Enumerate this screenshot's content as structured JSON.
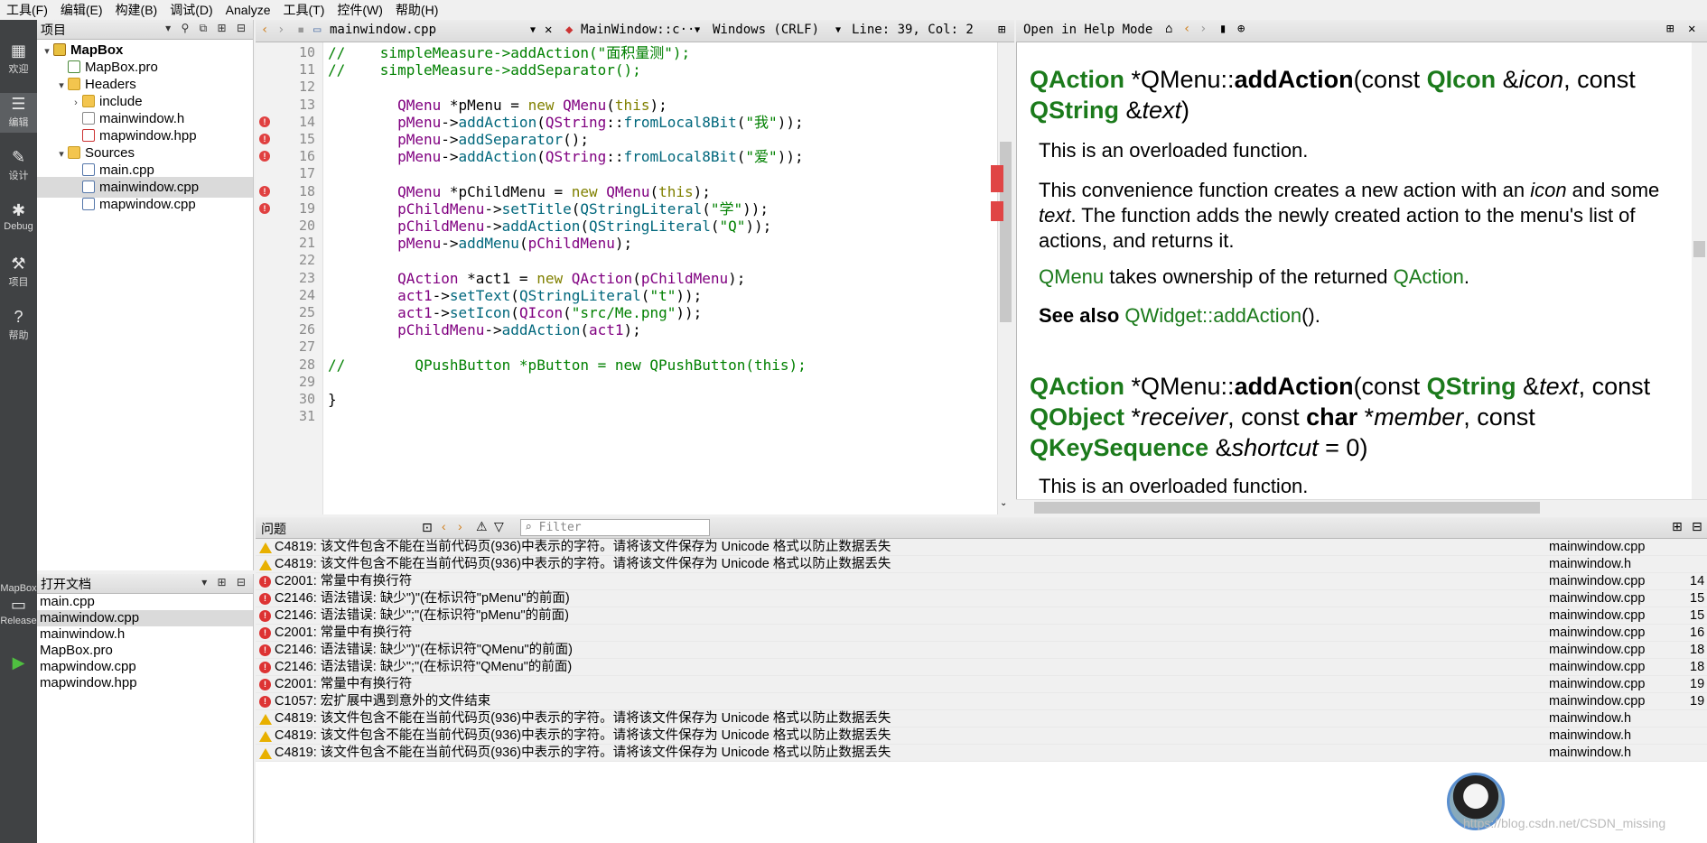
{
  "menubar": {
    "items": [
      {
        "label": "工具(F)"
      },
      {
        "label": "编辑(E)"
      },
      {
        "label": "构建(B)"
      },
      {
        "label": "调试(D)"
      },
      {
        "label": "Analyze"
      },
      {
        "label": "工具(T)"
      },
      {
        "label": "控件(W)"
      },
      {
        "label": "帮助(H)"
      }
    ]
  },
  "modebar": {
    "modes": [
      {
        "label": "欢迎",
        "icon": "grid-icon"
      },
      {
        "label": "编辑",
        "icon": "edit-icon"
      },
      {
        "label": "设计",
        "icon": "design-icon"
      },
      {
        "label": "Debug",
        "icon": "bug-icon"
      },
      {
        "label": "项目",
        "icon": "wrench-icon"
      },
      {
        "label": "帮助",
        "icon": "help-icon"
      }
    ],
    "kit_label": "MapBox",
    "build_label": "Release"
  },
  "project_pane": {
    "title": "项目",
    "tree": [
      {
        "label": "MapBox",
        "depth": 0,
        "kind": "root",
        "expanded": true
      },
      {
        "label": "MapBox.pro",
        "depth": 1,
        "kind": "pro"
      },
      {
        "label": "Headers",
        "depth": 1,
        "kind": "folder-h",
        "expanded": true
      },
      {
        "label": "include",
        "depth": 2,
        "kind": "folder",
        "expanded": false
      },
      {
        "label": "mainwindow.h",
        "depth": 2,
        "kind": "h"
      },
      {
        "label": "mapwindow.hpp",
        "depth": 2,
        "kind": "hpp"
      },
      {
        "label": "Sources",
        "depth": 1,
        "kind": "folder-s",
        "expanded": true
      },
      {
        "label": "main.cpp",
        "depth": 2,
        "kind": "cpp"
      },
      {
        "label": "mainwindow.cpp",
        "depth": 2,
        "kind": "cpp",
        "selected": true
      },
      {
        "label": "mapwindow.cpp",
        "depth": 2,
        "kind": "cpp"
      }
    ]
  },
  "open_docs": {
    "title": "打开文档",
    "items": [
      {
        "label": "main.cpp"
      },
      {
        "label": "mainwindow.cpp",
        "selected": true
      },
      {
        "label": "mainwindow.h"
      },
      {
        "label": "MapBox.pro"
      },
      {
        "label": "mapwindow.cpp"
      },
      {
        "label": "mapwindow.hpp"
      }
    ]
  },
  "editor": {
    "file_tab": "mainwindow.cpp",
    "symbol": "MainWindow::c···",
    "encoding": "Windows (CRLF)",
    "position": "Line: 39, Col: 2",
    "lines": [
      {
        "n": "10",
        "err": false,
        "html": "<span class=\"cm\">//    simpleMeasure-&gt;addAction(\"面积量测\");</span>"
      },
      {
        "n": "11",
        "err": false,
        "html": "<span class=\"cm\">//    simpleMeasure-&gt;addSeparator();</span>"
      },
      {
        "n": "12",
        "err": false,
        "html": ""
      },
      {
        "n": "13",
        "err": false,
        "html": "        <span class=\"ty\">QMenu</span> *pMenu = <span class=\"kw\">new</span> <span class=\"ty\">QMenu</span>(<span class=\"kw\">this</span>);"
      },
      {
        "n": "14",
        "err": true,
        "html": "        <span class=\"ty\">pMenu</span>-&gt;<span class=\"fn\">addAction</span>(<span class=\"ty\">QString</span>::<span class=\"fn\">fromLocal8Bit</span>(<span class=\"st\">\"我\"</span>));"
      },
      {
        "n": "15",
        "err": true,
        "html": "        <span class=\"ty\">pMenu</span>-&gt;<span class=\"fn\">addSeparator</span>();"
      },
      {
        "n": "16",
        "err": true,
        "html": "        <span class=\"ty\">pMenu</span>-&gt;<span class=\"fn\">addAction</span>(<span class=\"ty\">QString</span>::<span class=\"fn\">fromLocal8Bit</span>(<span class=\"st\">\"爱\"</span>));"
      },
      {
        "n": "17",
        "err": false,
        "html": ""
      },
      {
        "n": "18",
        "err": true,
        "html": "        <span class=\"ty\">QMenu</span> *pChildMenu = <span class=\"kw\">new</span> <span class=\"ty\">QMenu</span>(<span class=\"kw\">this</span>);"
      },
      {
        "n": "19",
        "err": true,
        "html": "        <span class=\"ty\">pChildMenu</span>-&gt;<span class=\"fn\">setTitle</span>(<span class=\"fn\">QStringLiteral</span>(<span class=\"st\">\"学\"</span>));"
      },
      {
        "n": "20",
        "err": false,
        "html": "        <span class=\"ty\">pChildMenu</span>-&gt;<span class=\"fn\">addAction</span>(<span class=\"fn\">QStringLiteral</span>(<span class=\"st\">\"Q\"</span>));"
      },
      {
        "n": "21",
        "err": false,
        "html": "        <span class=\"ty\">pMenu</span>-&gt;<span class=\"fn\">addMenu</span>(<span class=\"ty\">pChildMenu</span>);"
      },
      {
        "n": "22",
        "err": false,
        "html": ""
      },
      {
        "n": "23",
        "err": false,
        "html": "        <span class=\"ty\">QAction</span> *act1 = <span class=\"kw\">new</span> <span class=\"ty\">QAction</span>(<span class=\"ty\">pChildMenu</span>);"
      },
      {
        "n": "24",
        "err": false,
        "html": "        <span class=\"ty\">act1</span>-&gt;<span class=\"fn\">setText</span>(<span class=\"fn\">QStringLiteral</span>(<span class=\"st\">\"t\"</span>));"
      },
      {
        "n": "25",
        "err": false,
        "html": "        <span class=\"ty\">act1</span>-&gt;<span class=\"fn\">setIcon</span>(<span class=\"ty\">QIcon</span>(<span class=\"st\">\"src/Me.png\"</span>));"
      },
      {
        "n": "26",
        "err": false,
        "html": "        <span class=\"ty\">pChildMenu</span>-&gt;<span class=\"fn\">addAction</span>(<span class=\"ty\">act1</span>);"
      },
      {
        "n": "27",
        "err": false,
        "html": ""
      },
      {
        "n": "28",
        "err": false,
        "html": "<span class=\"cm\">//        QPushButton *pButton = new QPushButton(this);</span>"
      },
      {
        "n": "29",
        "err": false,
        "html": ""
      },
      {
        "n": "30",
        "err": false,
        "html": "}"
      },
      {
        "n": "31",
        "err": false,
        "html": ""
      }
    ]
  },
  "help": {
    "mode_label": "Open in Help Mode",
    "sig1_html": "<b class=\"q\">QAction</b> *QMenu::<b>addAction</b>(const <b class=\"q\">QIcon</b> &amp;<i>icon</i>, const <b class=\"q\">QString</b> &amp;<i>text</i>)",
    "p1": "This is an overloaded function.",
    "p2_html": "This convenience function creates a new action with an <i>icon</i> and some <i>text</i>. The function adds the newly created action to the menu's list of actions, and returns it.",
    "p3_html": "<span class=\"lnk\">QMenu</span> takes ownership of the returned <span class=\"lnk\">QAction</span>.",
    "p4_html": "<b>See also</b> <span class=\"lnk\">QWidget::addAction</span>().",
    "sig2_html": "<b class=\"q\">QAction</b> *QMenu::<b>addAction</b>(const <b class=\"q\">QString</b> &amp;<i>text</i>, const <b class=\"q\">QObject</b> *<i>receiver</i>, const <b>char</b> *<i>member</i>, const <b class=\"q\">QKeySequence</b> &amp;<i>shortcut</i> = 0)",
    "p5": "This is an overloaded function."
  },
  "issues": {
    "title": "问题",
    "filter_placeholder": "Filter",
    "rows": [
      {
        "type": "warning",
        "msg": "C4819: 该文件包含不能在当前代码页(936)中表示的字符。请将该文件保存为 Unicode 格式以防止数据丢失",
        "file": "mainwindow.cpp",
        "line": ""
      },
      {
        "type": "warning",
        "msg": "C4819: 该文件包含不能在当前代码页(936)中表示的字符。请将该文件保存为 Unicode 格式以防止数据丢失",
        "file": "mainwindow.h",
        "line": ""
      },
      {
        "type": "error",
        "msg": "C2001: 常量中有换行符",
        "file": "mainwindow.cpp",
        "line": "14"
      },
      {
        "type": "error",
        "msg": "C2146: 语法错误: 缺少\")\"(在标识符\"pMenu\"的前面)",
        "file": "mainwindow.cpp",
        "line": "15"
      },
      {
        "type": "error",
        "msg": "C2146: 语法错误: 缺少\";\"(在标识符\"pMenu\"的前面)",
        "file": "mainwindow.cpp",
        "line": "15"
      },
      {
        "type": "error",
        "msg": "C2001: 常量中有换行符",
        "file": "mainwindow.cpp",
        "line": "16"
      },
      {
        "type": "error",
        "msg": "C2146: 语法错误: 缺少\")\"(在标识符\"QMenu\"的前面)",
        "file": "mainwindow.cpp",
        "line": "18"
      },
      {
        "type": "error",
        "msg": "C2146: 语法错误: 缺少\";\"(在标识符\"QMenu\"的前面)",
        "file": "mainwindow.cpp",
        "line": "18"
      },
      {
        "type": "error",
        "msg": "C2001: 常量中有换行符",
        "file": "mainwindow.cpp",
        "line": "19"
      },
      {
        "type": "error",
        "msg": "C1057: 宏扩展中遇到意外的文件结束",
        "file": "mainwindow.cpp",
        "line": "19"
      },
      {
        "type": "warning",
        "msg": "C4819: 该文件包含不能在当前代码页(936)中表示的字符。请将该文件保存为 Unicode 格式以防止数据丢失",
        "file": "mainwindow.h",
        "line": ""
      },
      {
        "type": "warning",
        "msg": "C4819: 该文件包含不能在当前代码页(936)中表示的字符。请将该文件保存为 Unicode 格式以防止数据丢失",
        "file": "mainwindow.h",
        "line": ""
      },
      {
        "type": "warning",
        "msg": "C4819: 该文件包含不能在当前代码页(936)中表示的字符。请将该文件保存为 Unicode 格式以防止数据丢失",
        "file": "mainwindow.h",
        "line": ""
      }
    ]
  },
  "watermark": "https://blog.csdn.net/CSDN_missing",
  "colors": {
    "keyword": "#808000",
    "type": "#800080",
    "function": "#00677c",
    "string": "#008000",
    "error": "#dd3333",
    "warning": "#e8b000",
    "help_link": "#1b7a1b"
  }
}
